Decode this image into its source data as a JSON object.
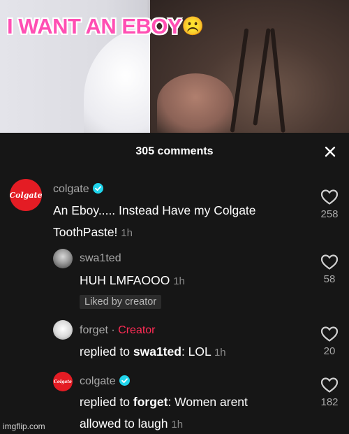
{
  "video": {
    "caption": "I WANT AN EBOY",
    "caption_emoji": "☹️"
  },
  "panel": {
    "title": "305 comments",
    "close_icon": "close-icon"
  },
  "comments": [
    {
      "username": "colgate",
      "verified": true,
      "avatar_label": "Colgate",
      "text_line1": "An Eboy..... Instead Have my Colgate",
      "text_line2": "ToothPaste!",
      "time": "1h",
      "likes": "258"
    },
    {
      "username": "swa1ted",
      "text": "HUH LMFAOOO",
      "time": "1h",
      "liked_by_creator": "Liked by creator",
      "likes": "58"
    },
    {
      "username": "forget",
      "separator": "·",
      "creator_label": "Creator",
      "reply_prefix": "replied to",
      "reply_to": "swa1ted",
      "text": ": LOL",
      "time": "1h",
      "likes": "20"
    },
    {
      "username": "colgate",
      "verified": true,
      "avatar_label": "Colgate",
      "reply_prefix": "replied to",
      "reply_to": "forget",
      "text_line1": ": Women arent",
      "text_line2": "allowed to laugh",
      "time": "1h",
      "likes": "182"
    }
  ],
  "watermark": "imgflip.com",
  "colors": {
    "background": "#161616",
    "creator_accent": "#fe2c55",
    "verified_blue": "#20d5ec",
    "colgate_red": "#e41c24",
    "caption_pink": "#ff4fb3"
  }
}
